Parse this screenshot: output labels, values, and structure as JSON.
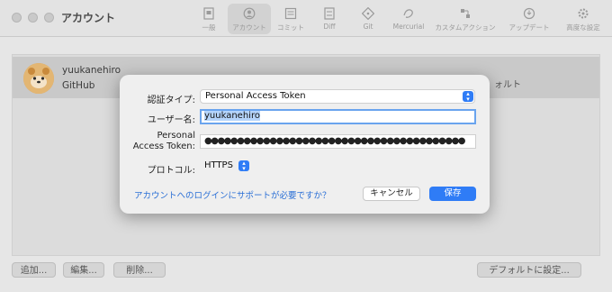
{
  "window": {
    "title": "アカウント"
  },
  "toolbar": {
    "items": [
      {
        "label": "一般",
        "icon": "general-icon"
      },
      {
        "label": "アカウント",
        "icon": "account-icon",
        "active": true
      },
      {
        "label": "コミット",
        "icon": "commit-icon"
      },
      {
        "label": "Diff",
        "icon": "diff-icon"
      },
      {
        "label": "Git",
        "icon": "git-icon"
      },
      {
        "label": "Mercurial",
        "icon": "mercurial-icon"
      },
      {
        "label": "カスタムアクション",
        "icon": "custom-actions-icon"
      },
      {
        "label": "アップデート",
        "icon": "update-icon"
      },
      {
        "label": "高度な設定",
        "icon": "advanced-icon"
      }
    ]
  },
  "account": {
    "name": "yuukanehiro",
    "host": "GitHub",
    "default_fragment": "ォルト"
  },
  "bottom": {
    "add": "追加...",
    "edit": "編集...",
    "delete": "削除...",
    "set_default": "デフォルトに設定..."
  },
  "dialog": {
    "auth_type_label": "認証タイプ:",
    "auth_type_value": "Personal Access Token",
    "username_label": "ユーザー名:",
    "username_value": "yuukanehiro",
    "token_label_line1": "Personal",
    "token_label_line2": "Access Token:",
    "token_value": "●●●●●●●●●●●●●●●●●●●●●●●●●●●●●●●●●●●●●●●●",
    "protocol_label": "プロトコル:",
    "protocol_value": "HTTPS",
    "help_link": "アカウントへのログインにサポートが必要ですか？",
    "cancel_label": "キャンセル",
    "save_label": "保存"
  },
  "colors": {
    "accent": "#2f7cf6",
    "link": "#2a6fd6",
    "selection": "#b4d4fb"
  }
}
